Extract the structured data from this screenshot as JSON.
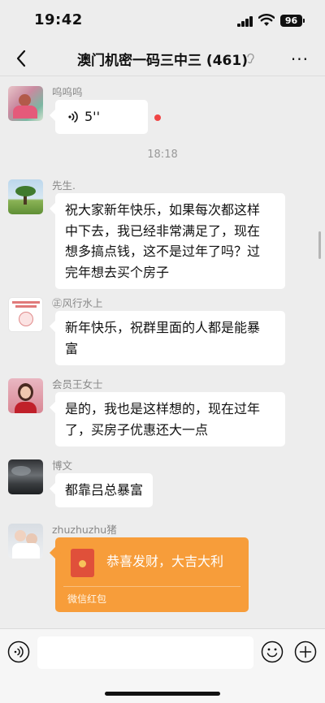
{
  "status": {
    "time": "19:42",
    "battery": "96"
  },
  "header": {
    "title": "澳门机密一码三中三 (461)"
  },
  "messages": [
    {
      "sender": "呜呜呜",
      "duration": "5''"
    },
    {
      "timestamp": "18:18"
    },
    {
      "sender": "先生.",
      "text": [
        "祝大家新年快乐，如果每次都这样",
        "中下去，我已经非常满足了，现在",
        "想多搞点钱，这不是过年了吗？过",
        "完年想去买个房子"
      ]
    },
    {
      "sender": "㊣风行水上",
      "text": [
        "新年快乐，祝群里面的人都是能暴",
        "富"
      ]
    },
    {
      "sender": "会员王女士",
      "text": [
        "是的，我也是这样想的，现在过年",
        "了，买房子优惠还大一点"
      ]
    },
    {
      "sender": "博文",
      "text": [
        "都靠吕总暴富"
      ]
    },
    {
      "sender": "zhuzhuzhu猪",
      "packet_title": "恭喜发财，大吉大利",
      "packet_footer": "微信红包"
    }
  ],
  "input": {
    "placeholder": ""
  },
  "icons": [
    "back-icon",
    "ear-icon",
    "more-icon",
    "voice-wave-icon",
    "voice-input-icon",
    "emoji-icon",
    "plus-icon"
  ],
  "colors": {
    "background": "#ededed",
    "bubble": "#ffffff",
    "red_packet": "#f79d3a",
    "unread_dot": "#f04545"
  }
}
